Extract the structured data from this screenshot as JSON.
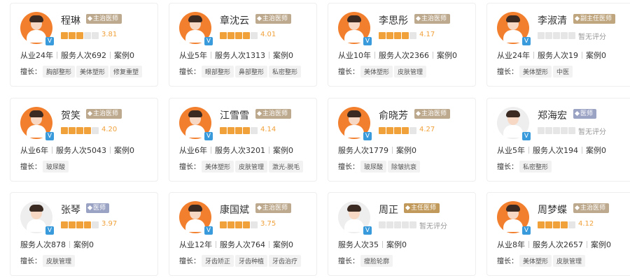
{
  "labels": {
    "skills_prefix": "擅长：",
    "v_badge": "V"
  },
  "doctors": [
    {
      "name": "程琳",
      "title": "主治医师",
      "title_type": "main",
      "stars": 3,
      "score": "3.81",
      "meta": [
        "从业24年",
        "服务人次692",
        "案例0"
      ],
      "skills": [
        "胸部整形",
        "美体塑形",
        "修复重塑"
      ],
      "avatar": "orange"
    },
    {
      "name": "章沈云",
      "title": "主治医师",
      "title_type": "main",
      "stars": 4,
      "score": "4.01",
      "meta": [
        "从业5年",
        "服务人次1313",
        "案例0"
      ],
      "skills": [
        "眼部整形",
        "鼻部整形",
        "私密整形"
      ],
      "avatar": "orange"
    },
    {
      "name": "李思彤",
      "title": "主治医师",
      "title_type": "main",
      "stars": 4,
      "score": "4.17",
      "meta": [
        "从业10年",
        "服务人次2366",
        "案例0"
      ],
      "skills": [
        "美体塑形",
        "皮肤管理"
      ],
      "avatar": "orange"
    },
    {
      "name": "李淑清",
      "title": "副主任医师",
      "title_type": "vice",
      "stars": 0,
      "score": "暂无评分",
      "meta": [
        "从业24年",
        "服务人次19",
        "案例0"
      ],
      "skills": [
        "美体塑形",
        "中医"
      ],
      "avatar": "orange"
    },
    {
      "name": "贺笑",
      "title": "主治医师",
      "title_type": "main",
      "stars": 4,
      "score": "4.20",
      "meta": [
        "从业6年",
        "服务人次5043",
        "案例0"
      ],
      "skills": [
        "玻尿酸"
      ],
      "avatar": "orange"
    },
    {
      "name": "江雪雪",
      "title": "主治医师",
      "title_type": "main",
      "stars": 4,
      "score": "4.14",
      "meta": [
        "从业6年",
        "服务人次3201",
        "案例0"
      ],
      "skills": [
        "美体塑形",
        "皮肤管理",
        "激光-脱毛"
      ],
      "avatar": "orange"
    },
    {
      "name": "俞晓芳",
      "title": "主治医师",
      "title_type": "main",
      "stars": 4,
      "score": "4.27",
      "meta": [
        "服务人次1779",
        "案例0"
      ],
      "skills": [
        "玻尿酸",
        "除皱抗衰"
      ],
      "avatar": "orange"
    },
    {
      "name": "郑海宏",
      "title": "医师",
      "title_type": "doc",
      "stars": 0,
      "score": "暂无评分",
      "meta": [
        "从业5年",
        "服务人次194",
        "案例0"
      ],
      "skills": [
        "私密整形"
      ],
      "avatar": "white"
    },
    {
      "name": "张琴",
      "title": "医师",
      "title_type": "doc",
      "stars": 4,
      "score": "3.97",
      "meta": [
        "服务人次878",
        "案例0"
      ],
      "skills": [
        "皮肤管理"
      ],
      "avatar": "white"
    },
    {
      "name": "康国斌",
      "title": "主治医师",
      "title_type": "main",
      "stars": 4,
      "score": "3.75",
      "meta": [
        "从业12年",
        "服务人次764",
        "案例0"
      ],
      "skills": [
        "牙齿矫正",
        "牙齿种植",
        "牙齿治疗"
      ],
      "avatar": "orange"
    },
    {
      "name": "周正",
      "title": "主任医师",
      "title_type": "chief",
      "stars": 0,
      "score": "暂无评分",
      "meta": [
        "服务人次35",
        "案例0"
      ],
      "skills": [
        "瘦脸轮廓"
      ],
      "avatar": "white"
    },
    {
      "name": "周梦蝶",
      "title": "主治医师",
      "title_type": "main",
      "stars": 4,
      "score": "4.12",
      "meta": [
        "从业8年",
        "服务人次2657",
        "案例0"
      ],
      "skills": [
        "美体塑形",
        "皮肤管理"
      ],
      "avatar": "orange"
    }
  ]
}
